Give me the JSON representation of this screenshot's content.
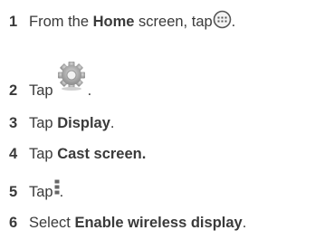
{
  "steps": [
    {
      "number": "1",
      "parts": [
        "From the ",
        "Home",
        " screen, tap ",
        "."
      ],
      "icon": "apps-icon"
    },
    {
      "number": "2",
      "parts": [
        "Tap ",
        "."
      ],
      "icon": "settings-gear-icon"
    },
    {
      "number": "3",
      "parts": [
        "Tap ",
        "Display",
        "."
      ]
    },
    {
      "number": "4",
      "parts": [
        "Tap ",
        "Cast screen."
      ]
    },
    {
      "number": "5",
      "parts": [
        "Tap ",
        "."
      ],
      "icon": "menu-icon"
    },
    {
      "number": "6",
      "parts": [
        "Select ",
        "Enable wireless display",
        "."
      ]
    }
  ]
}
